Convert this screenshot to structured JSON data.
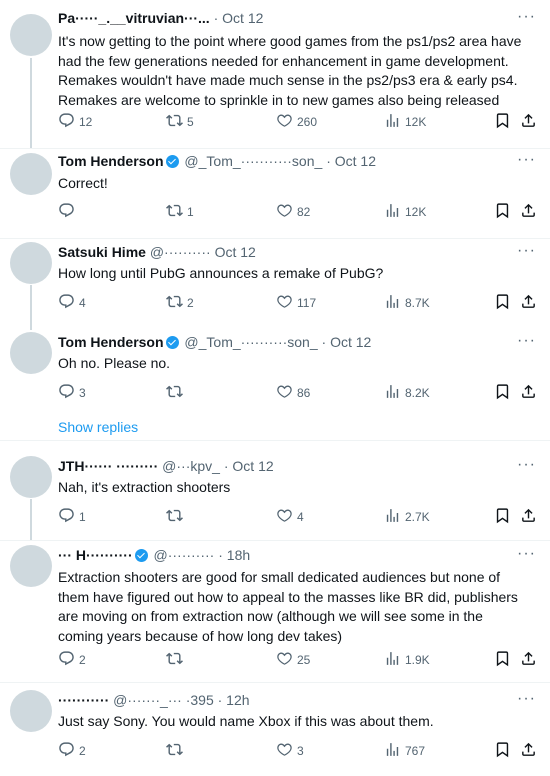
{
  "tweets": [
    {
      "name": "Pa·····_.__vitruvian···...",
      "handle": "",
      "time": "· Oct 12",
      "text_lines": [
        "It's now getting to the point where good games from the ps1/ps2 area have",
        "had the few generations needed for enhancement in game development.",
        "Remakes wouldn't have made much sense in the ps2/ps3 era & early ps4.",
        "Remakes are welcome to sprinkle in to new games also being released"
      ],
      "replies": "12",
      "reposts": "5",
      "likes": "260",
      "views": "12K"
    },
    {
      "name": "Tom Henderson",
      "handle": "@_Tom_···········son_",
      "time": "· Oct 12",
      "text_lines": [
        "Correct!"
      ],
      "replies": "",
      "reposts": "1",
      "likes": "82",
      "views": "12K"
    },
    {
      "name": "Satsuki Hime",
      "handle": "@··········",
      "time": "Oct 12",
      "text_lines": [
        "How long until PubG announces a remake of PubG?"
      ],
      "replies": "4",
      "reposts": "2",
      "likes": "117",
      "views": "8.7K"
    },
    {
      "name": "Tom Henderson",
      "handle": "@_Tom_··········son_",
      "time": "· Oct 12",
      "text_lines": [
        "Oh no. Please no."
      ],
      "replies": "3",
      "reposts": "",
      "likes": "86",
      "views": "8.2K"
    },
    {
      "name": "JTH······ ·········",
      "handle": "@···kpv_",
      "time": "· Oct 12",
      "text_lines": [
        "Nah, it's extraction shooters"
      ],
      "replies": "1",
      "reposts": "",
      "likes": "4",
      "views": "2.7K"
    },
    {
      "name": "··· H··········",
      "handle": "@··········",
      "time": "· 18h",
      "text_lines": [
        "Extraction shooters are good for small dedicated audiences but none of",
        "them have figured out how to appeal to the masses like BR did, publishers",
        "are moving on from extraction now (although we will see some in the",
        "coming years because of how long dev takes)"
      ],
      "replies": "2",
      "reposts": "",
      "likes": "25",
      "views": "1.9K"
    },
    {
      "name": "···········",
      "handle": "@·······_···",
      "time": "·395 · 12h",
      "text_lines": [
        "Just say Sony. You would name Xbox if this was about them."
      ],
      "replies": "2",
      "reposts": "",
      "likes": "3",
      "views": "767"
    }
  ],
  "show_replies_label": "Show replies",
  "more_glyph": "···",
  "icons": {
    "reply": "reply-icon",
    "repost": "repost-icon",
    "like": "like-icon",
    "views": "views-icon",
    "bookmark": "bookmark-icon",
    "share": "share-icon"
  },
  "colors": {
    "accent": "#1d9bf0",
    "text": "#0f1419",
    "muted": "#536471"
  }
}
